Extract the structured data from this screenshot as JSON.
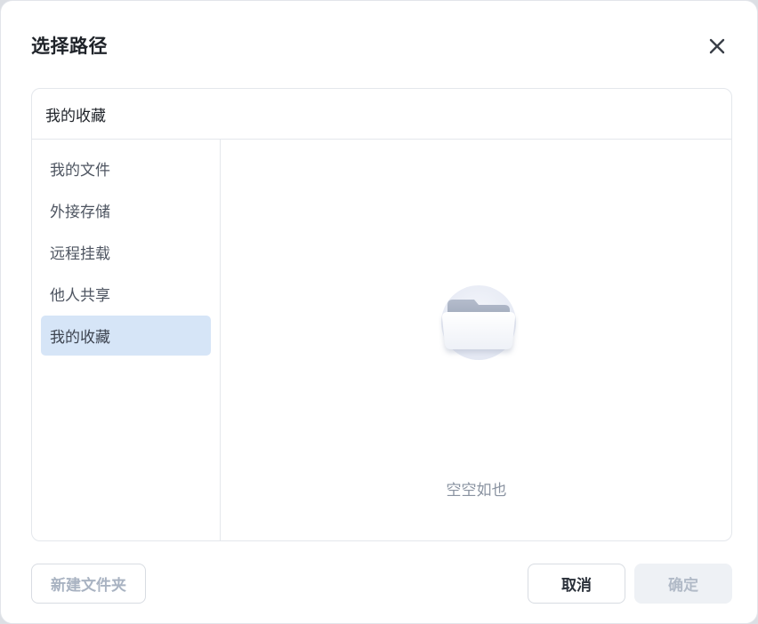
{
  "dialog": {
    "title": "选择路径"
  },
  "path_bar": {
    "current": "我的收藏"
  },
  "sidebar": {
    "items": [
      {
        "label": "我的文件",
        "active": false
      },
      {
        "label": "外接存储",
        "active": false
      },
      {
        "label": "远程挂载",
        "active": false
      },
      {
        "label": "他人共享",
        "active": false
      },
      {
        "label": "我的收藏",
        "active": true
      }
    ]
  },
  "content": {
    "empty_text": "空空如也",
    "empty_icon": "empty-folder-icon"
  },
  "footer": {
    "new_folder_label": "新建文件夹",
    "cancel_label": "取消",
    "confirm_label": "确定"
  },
  "colors": {
    "accent_selected": "#d6e5f7",
    "title": "#1f2329",
    "muted_text": "#8a93a1",
    "disabled_text": "#b1bac7"
  }
}
